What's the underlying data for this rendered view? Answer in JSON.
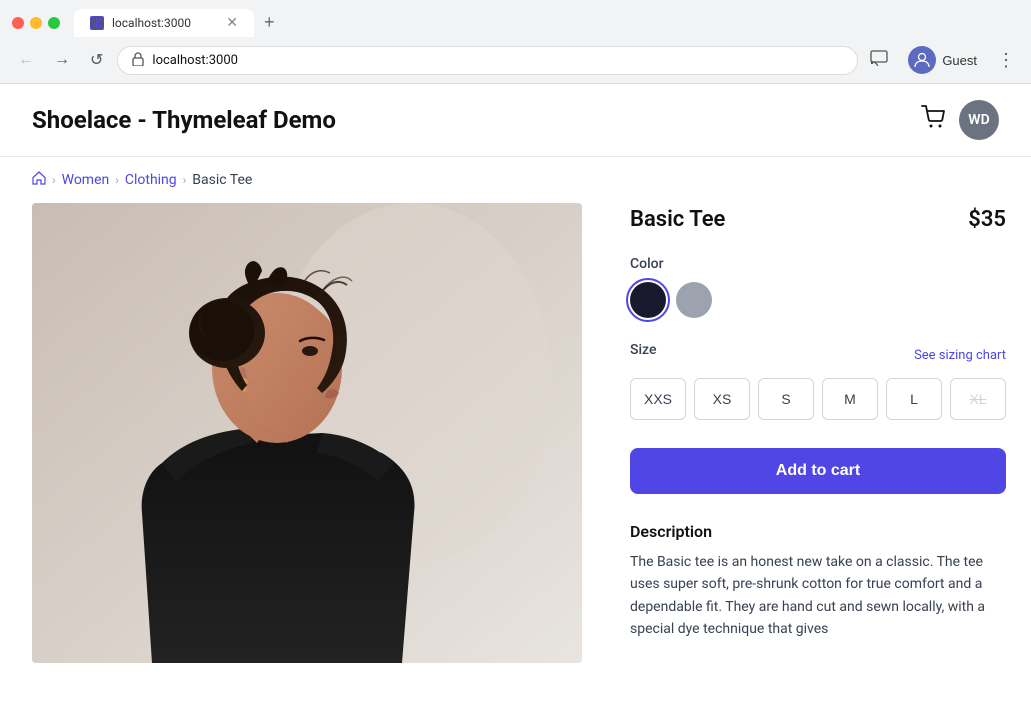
{
  "browser": {
    "tab_title": "localhost:3000",
    "tab_favicon": "globe",
    "url": "localhost:3000",
    "new_tab_label": "+",
    "nav": {
      "back_label": "←",
      "forward_label": "→",
      "reload_label": "↺"
    },
    "toolbar_right": {
      "cast_label": "⬜",
      "account_label": "Guest",
      "menu_label": "⋮"
    }
  },
  "header": {
    "site_title": "Shoelace - Thymeleaf Demo",
    "cart_icon": "cart",
    "user_initials": "WD"
  },
  "breadcrumb": {
    "home_icon": "🏠",
    "links": [
      {
        "label": "Women",
        "href": "#"
      },
      {
        "label": "Clothing",
        "href": "#"
      }
    ],
    "current": "Basic Tee"
  },
  "product": {
    "name": "Basic Tee",
    "price": "$35",
    "color_label": "Color",
    "colors": [
      {
        "name": "Black",
        "class": "color-black",
        "selected": true
      },
      {
        "name": "Gray",
        "class": "color-gray",
        "selected": false
      }
    ],
    "size_label": "Size",
    "sizing_chart_label": "See sizing chart",
    "sizes": [
      {
        "label": "XXS",
        "disabled": false
      },
      {
        "label": "XS",
        "disabled": false
      },
      {
        "label": "S",
        "disabled": false
      },
      {
        "label": "M",
        "disabled": false
      },
      {
        "label": "L",
        "disabled": false
      },
      {
        "label": "XL",
        "disabled": true
      }
    ],
    "add_to_cart_label": "Add to cart",
    "description_title": "Description",
    "description_text": "The Basic tee is an honest new take on a classic. The tee uses super soft, pre-shrunk cotton for true comfort and a dependable fit. They are hand cut and sewn locally, with a special dye technique that gives"
  }
}
